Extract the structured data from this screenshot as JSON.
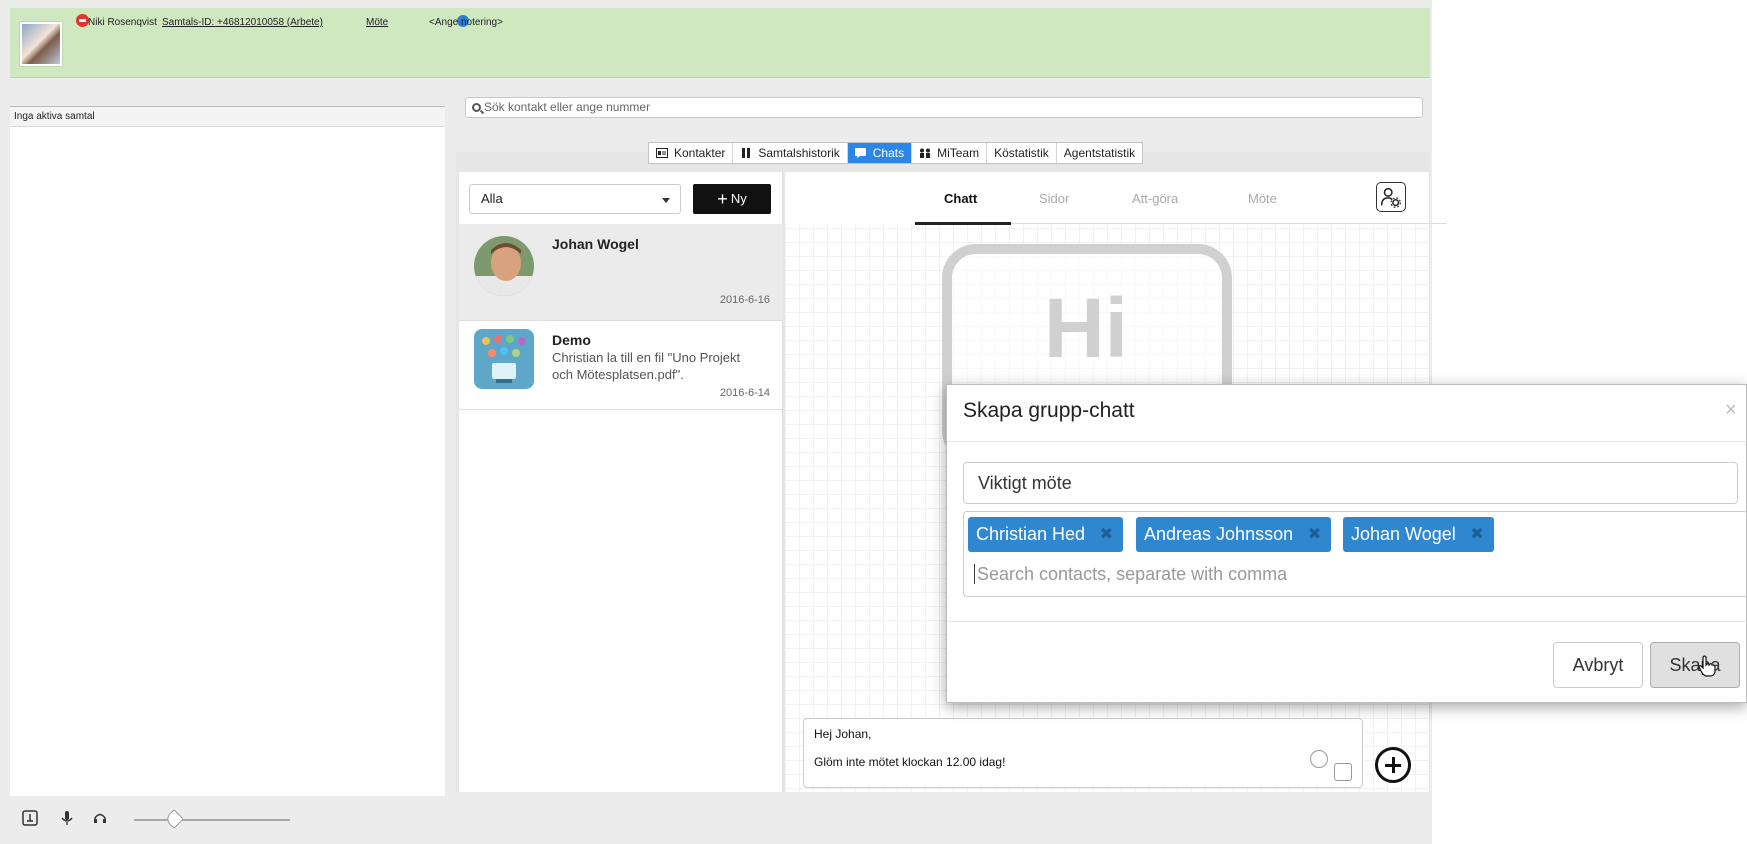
{
  "topbar": {
    "user_name": "Niki Rosenqvist",
    "call_id": "Samtals-ID: +46812010058 (Arbete)",
    "status": "Möte",
    "note": "<Ange notering>"
  },
  "left_pane": {
    "header": "Inga aktiva samtal"
  },
  "search": {
    "placeholder": "Sök kontakt eller ange nummer"
  },
  "tabs": [
    {
      "label": "Kontakter",
      "icon": "contacts-icon"
    },
    {
      "label": "Samtalshistorik",
      "icon": "history-icon"
    },
    {
      "label": "Chats",
      "icon": "chat-icon",
      "active": true
    },
    {
      "label": "MiTeam",
      "icon": "team-icon"
    },
    {
      "label": "Köstatistik"
    },
    {
      "label": "Agentstatistik"
    }
  ],
  "chat_list": {
    "filter_value": "Alla",
    "new_button": "Ny",
    "conversations": [
      {
        "name": "Johan Wogel",
        "message": "",
        "date": "2016-6-16",
        "selected": true
      },
      {
        "name": "Demo",
        "message": "Christian la till en fil \"Uno Projekt och Mötesplatsen.pdf\".",
        "date": "2016-6-14",
        "selected": false
      }
    ]
  },
  "chat_panel": {
    "subtabs": [
      "Chatt",
      "Sidor",
      "Att-göra",
      "Möte"
    ],
    "active_subtab": "Chatt",
    "logo_text": "Hi",
    "compose": {
      "line1": "Hej Johan,",
      "line2": "Glöm inte mötet klockan 12.00 idag!"
    }
  },
  "modal": {
    "title": "Skapa grupp-chatt",
    "close": "×",
    "name_value": "Viktigt möte",
    "members": [
      "Christian Hed",
      "Andreas Johnsson",
      "Johan Wogel"
    ],
    "members_placeholder": "Search contacts, separate with comma",
    "cancel": "Avbryt",
    "create": "Skapa"
  },
  "colors": {
    "topbar_bg": "#cfe8bf",
    "accent": "#2c86e6",
    "chip": "#2f87d0",
    "busy": "#e2342a"
  }
}
